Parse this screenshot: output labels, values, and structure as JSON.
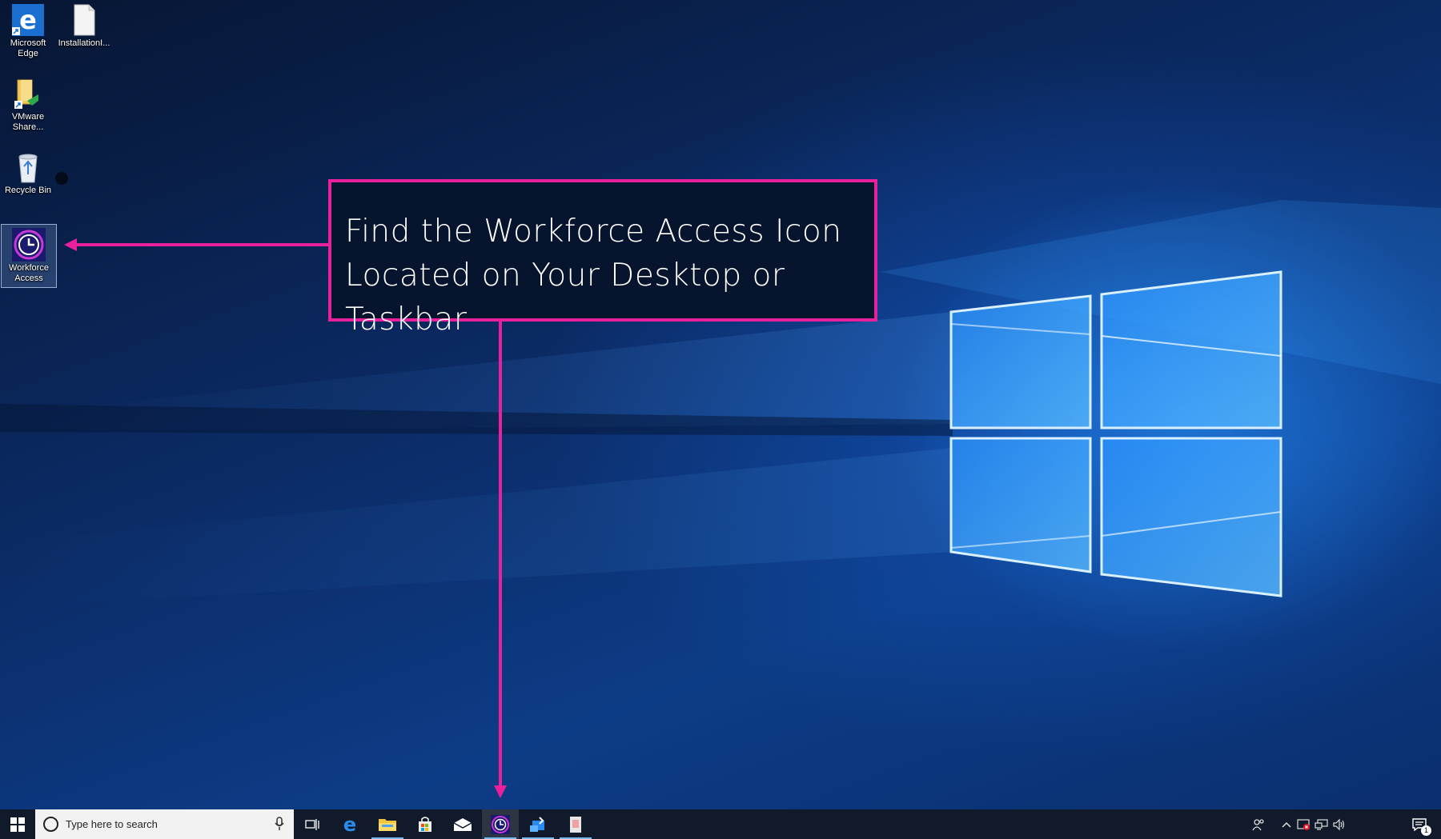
{
  "desktop": {
    "icons": [
      {
        "label": "Microsoft Edge"
      },
      {
        "label": "InstallationI..."
      },
      {
        "label": "VMware Share..."
      },
      {
        "label": "Recycle Bin"
      },
      {
        "label": "Workforce Access"
      }
    ]
  },
  "callout": {
    "text": "Find the Workforce Access Icon\nLocated on Your Desktop or Taskbar",
    "color": "#e8209c"
  },
  "taskbar": {
    "search_placeholder": "Type here to search",
    "pinned": [
      "task-view",
      "edge",
      "file-explorer",
      "store",
      "mail",
      "workforce-access",
      "app-blue",
      "app-doc"
    ],
    "notification_count": "1"
  },
  "colors": {
    "accent": "#e8209c",
    "taskbar": "#101a2a",
    "wallpaper": "#0b2a63"
  }
}
